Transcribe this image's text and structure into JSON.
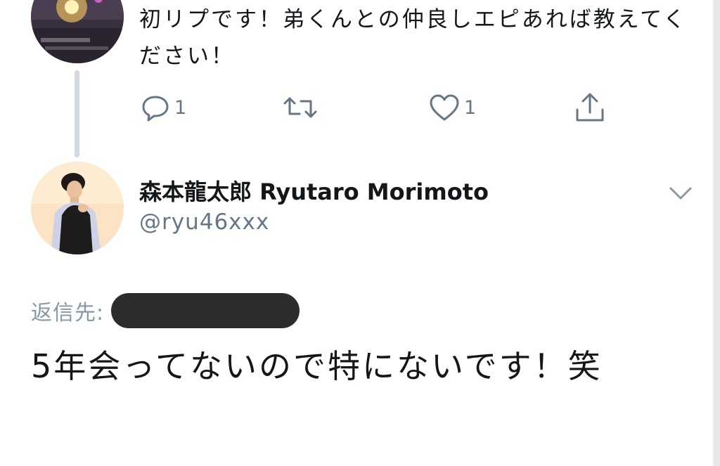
{
  "top_tweet": {
    "text": "初リプです！弟くんとの仲良しエピあれば教えてください！",
    "actions": {
      "reply_count": "1",
      "retweet_count": "",
      "like_count": "1"
    }
  },
  "main_tweet": {
    "display_name": "森本龍太郎 Ryutaro Morimoto",
    "handle": "@ryu46xxx",
    "reply_to_label": "返信先:",
    "text": "5年会ってないので特にないです！笑"
  },
  "icons": {
    "reply": "reply-icon",
    "retweet": "retweet-icon",
    "like": "heart-icon",
    "share": "share-icon",
    "menu": "chevron-down-icon"
  },
  "colors": {
    "text_primary": "#14171a",
    "text_secondary": "#657786",
    "thread_line": "#d4dadf",
    "redaction": "#2c2c2e"
  }
}
